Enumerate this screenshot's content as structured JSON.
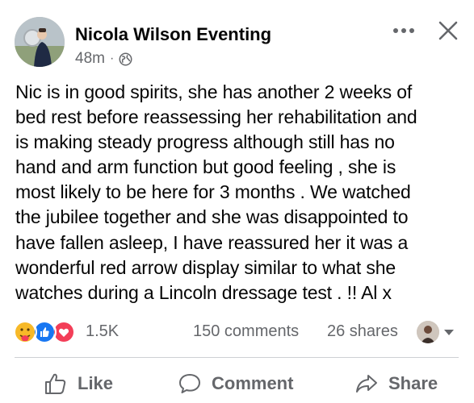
{
  "post": {
    "author": "Nicola Wilson Eventing",
    "time": "48m",
    "separator": "·",
    "privacy_icon": "globe-icon",
    "body_lines": [
      "Nic is in good spirits, she has another 2 weeks of",
      "bed rest before reassessing her rehabilitation and",
      "is making steady progress although still has no",
      "hand and arm function but good feeling , she is",
      "most likely to be here for 3 months . We watched",
      "the jubilee together and she was disappointed to",
      "have fallen asleep, I have reassured her it was a",
      "wonderful red arrow display similar to what she",
      "watches during a Lincoln dressage test . !! Al x"
    ]
  },
  "stats": {
    "reaction_icons": [
      "care-reaction-icon",
      "like-reaction-icon",
      "love-reaction-icon"
    ],
    "reactions_count": "1.5K",
    "comments": "150 comments",
    "shares": "26 shares"
  },
  "actions": {
    "like": "Like",
    "comment": "Comment",
    "share": "Share"
  },
  "colors": {
    "text": "#050505",
    "secondary": "#65676b",
    "like_blue": "#1877f2",
    "love_red": "#f33e58",
    "care_yellow": "#f7b928",
    "divider": "#ced0d4"
  }
}
